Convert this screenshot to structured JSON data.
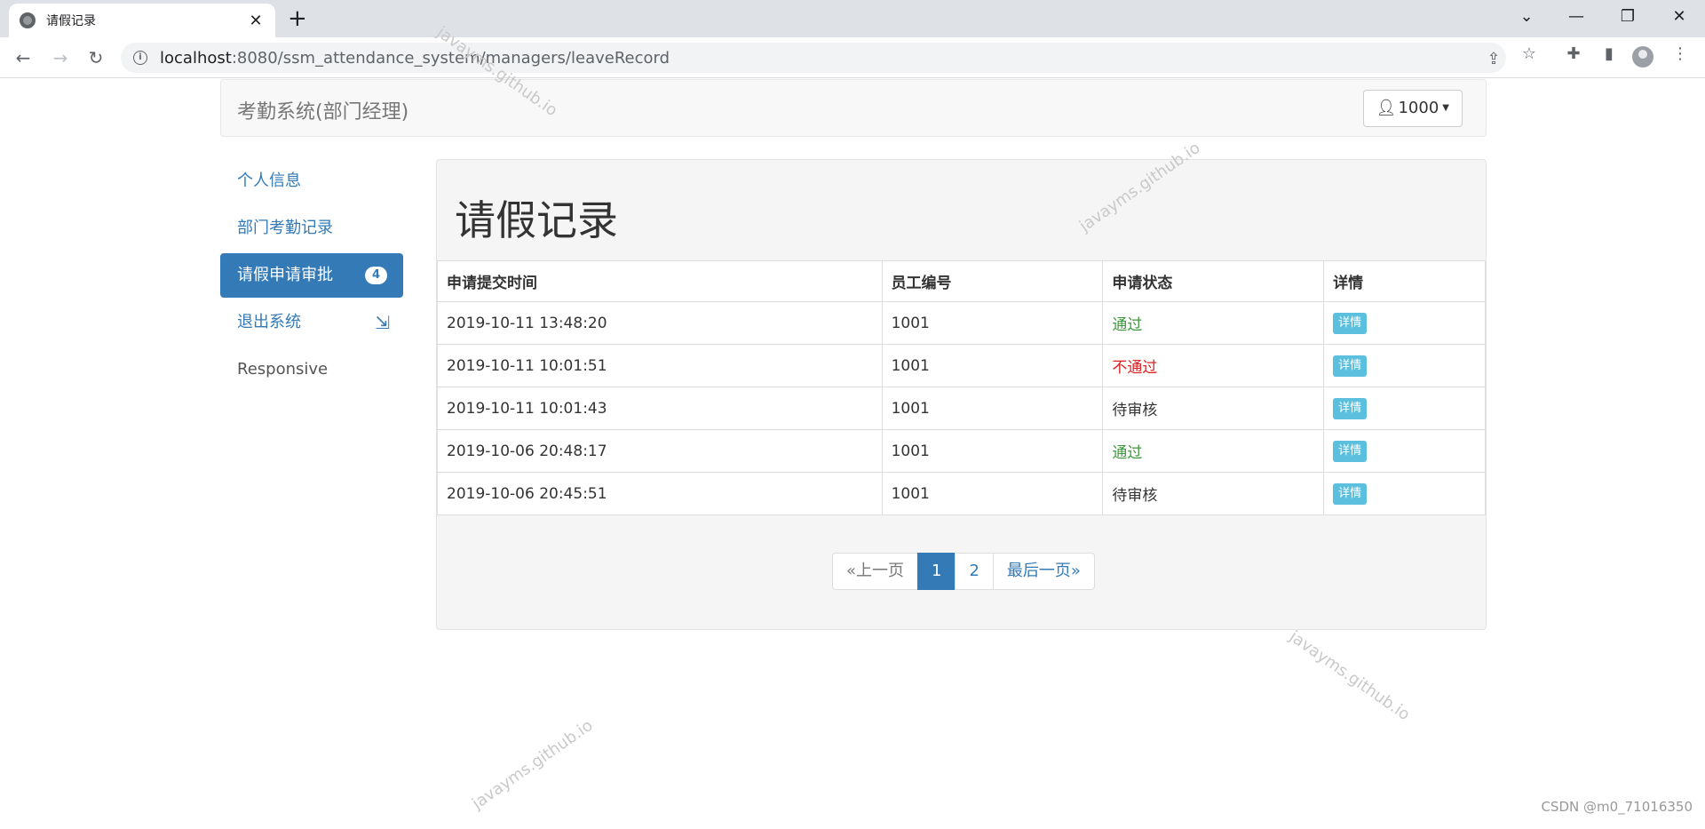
{
  "browser": {
    "tab_title": "请假记录",
    "close_tab": "✕",
    "new_tab": "+",
    "url_host": "localhost",
    "url_rest": ":8080/ssm_attendance_system/managers/leaveRecord"
  },
  "navbar": {
    "brand": "考勤系统(部门经理)",
    "user": "1000"
  },
  "sidebar": {
    "items": [
      {
        "label": "个人信息"
      },
      {
        "label": "部门考勤记录"
      },
      {
        "label": "请假申请审批",
        "badge": "4"
      },
      {
        "label": "退出系统"
      },
      {
        "label": "Responsive"
      }
    ]
  },
  "main": {
    "title": "请假记录",
    "table": {
      "headers": [
        "申请提交时间",
        "员工编号",
        "申请状态",
        "详情"
      ],
      "rows": [
        {
          "time": "2019-10-11 13:48:20",
          "emp": "1001",
          "status": "通过",
          "detail": "详情"
        },
        {
          "time": "2019-10-11 10:01:51",
          "emp": "1001",
          "status": "不通过",
          "detail": "详情"
        },
        {
          "time": "2019-10-11 10:01:43",
          "emp": "1001",
          "status": "待审核",
          "detail": "详情"
        },
        {
          "time": "2019-10-06 20:48:17",
          "emp": "1001",
          "status": "通过",
          "detail": "详情"
        },
        {
          "time": "2019-10-06 20:45:51",
          "emp": "1001",
          "status": "待审核",
          "detail": "详情"
        }
      ]
    },
    "pagination": {
      "prev": "«上一页",
      "pages": [
        "1",
        "2"
      ],
      "last": "最后一页»"
    }
  },
  "watermark": "javayms.github.io",
  "footer_credit": "CSDN @m0_71016350",
  "colors": {
    "primary": "#337ab7",
    "info": "#5bc0de",
    "success": "#3c9a3c",
    "danger": "#e02020"
  }
}
